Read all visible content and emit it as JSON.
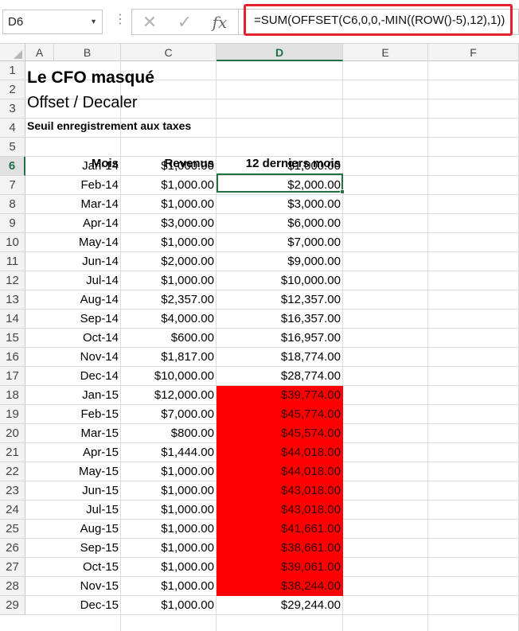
{
  "name_box": {
    "value": "D6"
  },
  "formula_bar": {
    "formula": "=SUM(OFFSET(C6,0,0,-MIN((ROW()-5),12),1))",
    "fx_label": "fx",
    "cancel_glyph": "✕",
    "enter_glyph": "✓"
  },
  "columns": [
    "A",
    "B",
    "C",
    "D",
    "E",
    "F"
  ],
  "active_column": "D",
  "active_row": 6,
  "titles": {
    "main": "Le CFO masqué",
    "sub": "Offset / Decaler",
    "note": "Seuil enregistrement aux taxes"
  },
  "table": {
    "headers": {
      "mois": "Mois",
      "revenus": "Revenus",
      "last12": "12 derniers mois"
    },
    "rows": [
      {
        "row": 6,
        "mois": "Jan-14",
        "revenus": "$1,000.00",
        "last12": "$1,000.00",
        "highlight": false
      },
      {
        "row": 7,
        "mois": "Feb-14",
        "revenus": "$1,000.00",
        "last12": "$2,000.00",
        "highlight": false
      },
      {
        "row": 8,
        "mois": "Mar-14",
        "revenus": "$1,000.00",
        "last12": "$3,000.00",
        "highlight": false
      },
      {
        "row": 9,
        "mois": "Apr-14",
        "revenus": "$3,000.00",
        "last12": "$6,000.00",
        "highlight": false
      },
      {
        "row": 10,
        "mois": "May-14",
        "revenus": "$1,000.00",
        "last12": "$7,000.00",
        "highlight": false
      },
      {
        "row": 11,
        "mois": "Jun-14",
        "revenus": "$2,000.00",
        "last12": "$9,000.00",
        "highlight": false
      },
      {
        "row": 12,
        "mois": "Jul-14",
        "revenus": "$1,000.00",
        "last12": "$10,000.00",
        "highlight": false
      },
      {
        "row": 13,
        "mois": "Aug-14",
        "revenus": "$2,357.00",
        "last12": "$12,357.00",
        "highlight": false
      },
      {
        "row": 14,
        "mois": "Sep-14",
        "revenus": "$4,000.00",
        "last12": "$16,357.00",
        "highlight": false
      },
      {
        "row": 15,
        "mois": "Oct-14",
        "revenus": "$600.00",
        "last12": "$16,957.00",
        "highlight": false
      },
      {
        "row": 16,
        "mois": "Nov-14",
        "revenus": "$1,817.00",
        "last12": "$18,774.00",
        "highlight": false
      },
      {
        "row": 17,
        "mois": "Dec-14",
        "revenus": "$10,000.00",
        "last12": "$28,774.00",
        "highlight": false
      },
      {
        "row": 18,
        "mois": "Jan-15",
        "revenus": "$12,000.00",
        "last12": "$39,774.00",
        "highlight": true
      },
      {
        "row": 19,
        "mois": "Feb-15",
        "revenus": "$7,000.00",
        "last12": "$45,774.00",
        "highlight": true
      },
      {
        "row": 20,
        "mois": "Mar-15",
        "revenus": "$800.00",
        "last12": "$45,574.00",
        "highlight": true
      },
      {
        "row": 21,
        "mois": "Apr-15",
        "revenus": "$1,444.00",
        "last12": "$44,018.00",
        "highlight": true
      },
      {
        "row": 22,
        "mois": "May-15",
        "revenus": "$1,000.00",
        "last12": "$44,018.00",
        "highlight": true
      },
      {
        "row": 23,
        "mois": "Jun-15",
        "revenus": "$1,000.00",
        "last12": "$43,018.00",
        "highlight": true
      },
      {
        "row": 24,
        "mois": "Jul-15",
        "revenus": "$1,000.00",
        "last12": "$43,018.00",
        "highlight": true
      },
      {
        "row": 25,
        "mois": "Aug-15",
        "revenus": "$1,000.00",
        "last12": "$41,661.00",
        "highlight": true
      },
      {
        "row": 26,
        "mois": "Sep-15",
        "revenus": "$1,000.00",
        "last12": "$38,661.00",
        "highlight": true
      },
      {
        "row": 27,
        "mois": "Oct-15",
        "revenus": "$1,000.00",
        "last12": "$39,061.00",
        "highlight": true
      },
      {
        "row": 28,
        "mois": "Nov-15",
        "revenus": "$1,000.00",
        "last12": "$38,244.00",
        "highlight": true
      },
      {
        "row": 29,
        "mois": "Dec-15",
        "revenus": "$1,000.00",
        "last12": "$29,244.00",
        "highlight": false
      }
    ]
  },
  "colors": {
    "highlight_fill": "#ff0000",
    "selection": "#217346",
    "formula_outline": "#e3202b"
  }
}
